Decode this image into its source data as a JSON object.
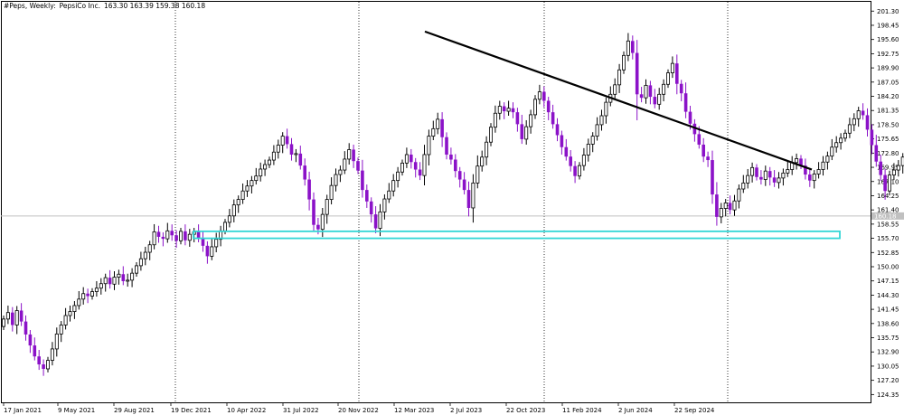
{
  "header": {
    "symbol": "#Peps, Weekly:",
    "name": "PepsiCo Inc.",
    "ohlc": "163.30 163.39 159.38 160.18"
  },
  "colors": {
    "bull": "#000000",
    "bear": "#8b12c8",
    "trendline": "#000000",
    "support_box": "#33d6d6",
    "grid": "#000000",
    "price_line": "#c0c0c0",
    "last_price_bg": "#c0c0c0"
  },
  "chart_data": {
    "type": "candlestick",
    "symbol": "#Peps",
    "timeframe": "Weekly",
    "ylim": [
      122.6,
      202.8
    ],
    "y_ticks": [
      "201.30",
      "198.45",
      "195.60",
      "192.75",
      "189.90",
      "187.05",
      "184.20",
      "181.35",
      "178.50",
      "175.65",
      "172.80",
      "169.95",
      "167.10",
      "164.25",
      "161.40",
      "158.55",
      "155.70",
      "152.85",
      "150.00",
      "147.15",
      "144.30",
      "141.45",
      "138.60",
      "135.75",
      "132.90",
      "130.05",
      "127.20",
      "124.35"
    ],
    "x_ticks": [
      "17 Jan 2021",
      "9 May 2021",
      "29 Aug 2021",
      "19 Dec 2021",
      "10 Apr 2022",
      "31 Jul 2022",
      "20 Nov 2022",
      "12 Mar 2023",
      "2 Jul 2023",
      "22 Oct 2023",
      "11 Feb 2024",
      "2 Jun 2024",
      "22 Sep 2024"
    ],
    "last_price": "160.18",
    "trendline": {
      "from": [
        "12 Mar 2023",
        197.2
      ],
      "to": [
        "Feb 2025",
        169.5
      ]
    },
    "support_zone": {
      "from": "Feb 2022",
      "to": "Mar 2025",
      "low": 155.7,
      "high": 157.1
    },
    "vertical_grid_dates": [
      "19 Dec 2021",
      "20 Nov 2022",
      "22 Oct 2023",
      "Nov 2024"
    ],
    "closes": [
      139.5,
      140.8,
      138.3,
      141.2,
      139.0,
      136.4,
      134.2,
      132.0,
      130.4,
      129.5,
      131.2,
      133.5,
      136.5,
      138.3,
      140.2,
      141.0,
      142.2,
      143.5,
      144.6,
      144.1,
      145.0,
      145.7,
      146.6,
      147.8,
      146.5,
      147.9,
      148.5,
      147.1,
      147.3,
      148.7,
      150.2,
      151.6,
      152.9,
      154.4,
      157.0,
      156.0,
      155.6,
      157.2,
      156.3,
      155.2,
      157.1,
      155.3,
      156.5,
      157.0,
      155.8,
      154.2,
      152.1,
      154.0,
      155.5,
      157.2,
      158.9,
      160.2,
      162.4,
      163.5,
      165.2,
      166.2,
      167.3,
      168.2,
      169.6,
      170.5,
      171.4,
      173.0,
      174.4,
      176.2,
      174.6,
      172.5,
      172.7,
      170.3,
      167.5,
      163.5,
      158.4,
      157.5,
      160.5,
      163.5,
      166.3,
      168.5,
      169.4,
      171.6,
      173.5,
      171.2,
      169.3,
      165.4,
      163.1,
      160.5,
      157.7,
      161.0,
      163.6,
      165.2,
      167.3,
      169.0,
      170.8,
      172.5,
      171.0,
      169.5,
      168.3,
      172.5,
      176.2,
      177.7,
      179.6,
      176.0,
      172.5,
      171.5,
      169.2,
      167.5,
      165.4,
      161.8,
      166.8,
      170.2,
      172.0,
      175.0,
      178.0,
      180.8,
      182.2,
      181.2,
      181.8,
      181.0,
      178.6,
      175.6,
      178.1,
      180.5,
      183.6,
      185.1,
      183.3,
      181.0,
      178.6,
      176.4,
      174.0,
      172.1,
      170.2,
      168.2,
      170.3,
      172.4,
      174.6,
      176.2,
      178.5,
      180.3,
      183.0,
      184.6,
      186.5,
      189.5,
      192.4,
      195.3,
      192.9,
      184.6,
      183.9,
      186.4,
      184.1,
      182.6,
      184.6,
      186.6,
      188.9,
      190.8,
      186.7,
      184.8,
      181.1,
      178.7,
      176.6,
      174.5,
      172.1,
      171.4,
      164.5,
      160.0,
      161.7,
      162.8,
      161.4,
      163.2,
      165.6,
      166.8,
      168.3,
      169.9,
      168.0,
      167.5,
      169.2,
      167.9,
      166.9,
      167.8,
      168.8,
      169.5,
      170.9,
      171.7,
      170.3,
      168.5,
      167.3,
      168.6,
      169.5,
      171.0,
      172.2,
      174.0,
      174.9,
      175.8,
      176.8,
      178.5,
      179.7,
      181.3,
      180.4,
      177.5,
      174.4,
      171.1,
      168.4,
      165.2,
      168.4,
      169.4,
      170.3,
      172.0,
      173.2,
      175.9,
      178.4,
      177.0,
      174.3,
      171.4,
      170.1,
      174.3,
      175.7,
      172.0,
      169.0,
      166.1,
      161.4,
      158.4,
      159.0,
      161.0,
      160.2
    ]
  }
}
